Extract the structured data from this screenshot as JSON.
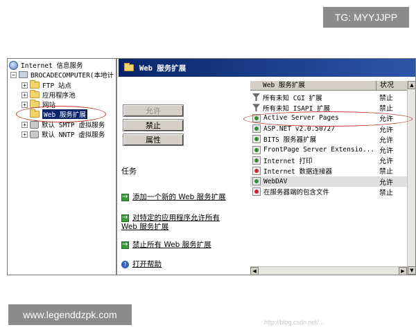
{
  "watermarks": {
    "top": "TG: MYYJJPP",
    "bottom": "www.legenddzpk.com",
    "faint": "http://blog.csdn.net/..."
  },
  "tree": {
    "root": "Internet 信息服务",
    "computer": "BROCADECOMPUTER(本地计",
    "items": [
      "FTP 站点",
      "应用程序池",
      "网站",
      "Web 服务扩展",
      "默认 SMTP 虚拟服务",
      "默认 NNTP 虚拟服务"
    ]
  },
  "header": {
    "title": "Web 服务扩展"
  },
  "buttons": {
    "allow": "允许",
    "forbid": "禁止",
    "properties": "属性"
  },
  "tasks": {
    "title": "任务",
    "add_new": "添加一个新的 Web 服务扩展",
    "allow_all_line1": "对特定的应用程序允许所有",
    "allow_all_line2": "Web 服务扩展",
    "forbid_all": "禁止所有 Web 服务扩展",
    "help": "打开帮助"
  },
  "list": {
    "col_name": "Web 服务扩展",
    "col_status": "状况",
    "rows": [
      {
        "name": "所有未知 CGI 扩展",
        "status": "禁止",
        "icon": "filter"
      },
      {
        "name": "所有未知 ISAPI 扩展",
        "status": "禁止",
        "icon": "filter"
      },
      {
        "name": "Active Server Pages",
        "status": "允许",
        "icon": "allowed"
      },
      {
        "name": "ASP.NET v2.0.50727",
        "status": "允许",
        "icon": "allowed"
      },
      {
        "name": "BITS 服务器扩展",
        "status": "允许",
        "icon": "allowed"
      },
      {
        "name": "FrontPage Server Extensio...",
        "status": "允许",
        "icon": "allowed"
      },
      {
        "name": "Internet 打印",
        "status": "允许",
        "icon": "allowed"
      },
      {
        "name": "Internet 数据连接器",
        "status": "禁止",
        "icon": "forbidden"
      },
      {
        "name": "WebDAV",
        "status": "允许",
        "icon": "allowed"
      },
      {
        "name": "在服务器端的包含文件",
        "status": "禁止",
        "icon": "forbidden"
      }
    ]
  }
}
